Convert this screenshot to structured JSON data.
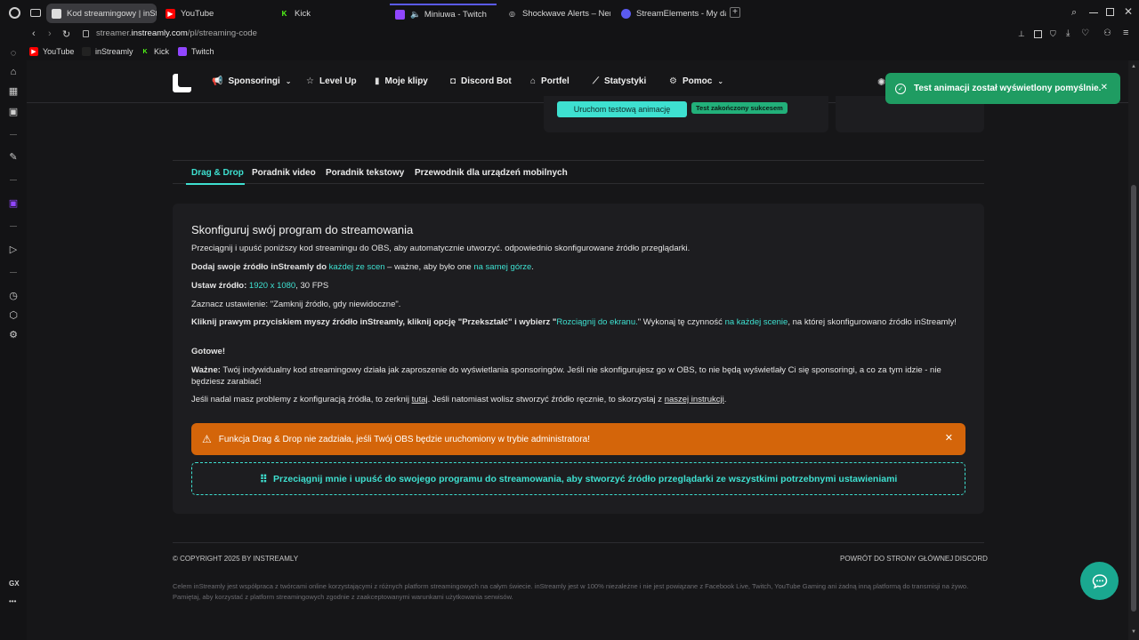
{
  "browser": {
    "tabs": [
      {
        "label": "Kod streamingowy | inStre",
        "color": "#888888"
      },
      {
        "label": "YouTube",
        "color": "#ff0000"
      },
      {
        "label": "Kick",
        "color": "#53fc18"
      },
      {
        "label": "Miniuwa - Twitch",
        "color": "#9146ff"
      },
      {
        "label": "Shockwave Alerts – Nerd",
        "color": "#dddddd"
      },
      {
        "label": "StreamElements - My das",
        "color": "#5a5af0"
      }
    ],
    "url_prefix": "streamer.",
    "url_domain": "instreamly.com",
    "url_path": "/pl/streaming-code",
    "bookmarks": [
      {
        "label": "YouTube",
        "color": "#ff0000"
      },
      {
        "label": "inStreamly",
        "color": "#222222"
      },
      {
        "label": "Kick",
        "color": "#53fc18"
      },
      {
        "label": "Twitch",
        "color": "#9146ff"
      }
    ],
    "sidebar_gx": "GX",
    "sidebar_more": "•••"
  },
  "nav": {
    "items": [
      {
        "label": "Sponsoringi",
        "icon": "megaphone-icon"
      },
      {
        "label": "Level Up",
        "icon": "star-icon"
      },
      {
        "label": "Moje klipy",
        "icon": "film-icon"
      },
      {
        "label": "Discord Bot",
        "icon": "discord-icon"
      },
      {
        "label": "Portfel",
        "icon": "wallet-icon"
      },
      {
        "label": "Statystyki",
        "icon": "chart-icon"
      },
      {
        "label": "Pomoc",
        "icon": "help-icon"
      }
    ]
  },
  "test": {
    "button_label": "Uruchom testową animację",
    "badge": "Test zakończony sukcesem"
  },
  "tabs": [
    "Drag & Drop",
    "Poradnik video",
    "Poradnik tekstowy",
    "Przewodnik dla urządzeń mobilnych"
  ],
  "guide": {
    "title": "Skonfiguruj swój program do streamowania",
    "p1": "Przeciągnij i upuść poniższy kod streamingu do OBS, aby automatycznie utworzyć. odpowiednio skonfigurowane źródło przeglądarki.",
    "p2_a": "Dodaj swoje źródło inStreamly do ",
    "p2_b": "każdej ze scen",
    "p2_c": " – ważne, aby było one ",
    "p2_d": "na samej górze",
    "p2_e": ".",
    "p3_a": "Ustaw źródło: ",
    "p3_b": "1920 x 1080",
    "p3_c": ", 30 FPS",
    "p4": "Zaznacz ustawienie: \"Zamknij źródło, gdy niewidoczne\".",
    "p5_a": "Kliknij prawym przyciskiem myszy źródło inStreamly, kliknij opcję \"Przekształć\" i wybierz \"",
    "p5_b": "Rozciągnij do ekranu.",
    "p5_c": "\" Wykonaj tę czynność ",
    "p5_d": "na każdej scenie",
    "p5_e": ", na której skonfigurowano źródło inStreamly!",
    "p6": "Gotowe!",
    "p7_a": "Ważne:",
    "p7_b": " Twój indywidualny kod streamingowy działa jak zaproszenie do wyświetlania sponsoringów. Jeśli nie skonfigurujesz go w OBS, to nie będą wyświetlały Ci się sponsoringi, a co za tym idzie - nie będziesz zarabiać!",
    "p8_a": "Jeśli nadal masz problemy z konfiguracją źródła, to zerknij ",
    "p8_b": "tutaj",
    "p8_c": ". Jeśli natomiast wolisz stworzyć źródło ręcznie, to skorzystaj z ",
    "p8_d": "naszej instrukcji",
    "p8_e": "."
  },
  "warning": "Funkcja Drag & Drop nie zadziała, jeśli Twój OBS będzie uruchomiony w trybie administratora!",
  "drag_label": "Przeciągnij mnie i upuść do swojego programu do streamowania, aby stworzyć źródło przeglądarki ze wszystkimi potrzebnymi ustawieniami",
  "footer": {
    "copyright": "© COPYRIGHT 2025 BY INSTREAMLY",
    "home_link": "POWRÓT DO STRONY GŁÓWNEJ",
    "discord_link": "DISCORD",
    "note": "Celem inStreamly jest współpraca z twórcami online korzystającymi z różnych platform streamingowych na całym świecie. inStreamly jest w 100% niezależne i nie jest powiązane z Facebook Live, Twitch, YouTube Gaming ani żadną inną platformą do transmisji na żywo. Pamiętaj, aby korzystać z platform streamingowych zgodnie z zaakceptowanymi warunkami użytkowania serwisów."
  },
  "toast": "Test animacji został wyświetlony pomyślnie.",
  "colors": {
    "accent": "#3ee0d0",
    "warning": "#d4650a",
    "success": "#1f9c62"
  }
}
